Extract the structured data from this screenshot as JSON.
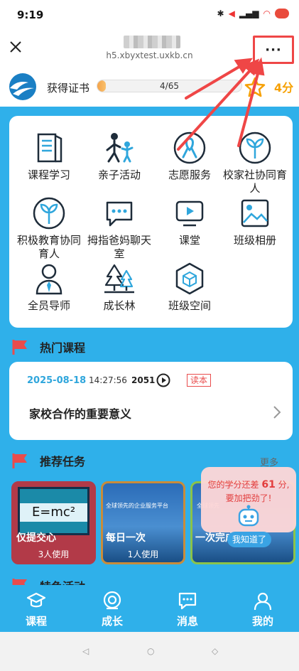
{
  "status": {
    "time": "9:19",
    "icons": [
      "bluetooth-icon",
      "mute-icon",
      "signal-icon",
      "wifi-icon",
      "battery-icon"
    ]
  },
  "browser": {
    "url": "h5.xbyxtest.uxkb.cn",
    "more_label": "···"
  },
  "cert": {
    "label": "获得证书",
    "progress_text": "4/65",
    "progress_fraction": 0.0615,
    "score": "4分"
  },
  "menu": [
    {
      "label": "课程学习",
      "icon": "book-icon"
    },
    {
      "label": "亲子活动",
      "icon": "family-icon"
    },
    {
      "label": "志愿服务",
      "icon": "ribbon-icon"
    },
    {
      "label": "校家社协同育人",
      "icon": "sprout-icon"
    },
    {
      "label": "积极教育协同育人",
      "icon": "sprout-icon"
    },
    {
      "label": "拇指爸妈聊天室",
      "icon": "chat-icon"
    },
    {
      "label": "课堂",
      "icon": "video-screen-icon"
    },
    {
      "label": "班级相册",
      "icon": "album-icon"
    },
    {
      "label": "全员导师",
      "icon": "mentor-icon"
    },
    {
      "label": "成长林",
      "icon": "trees-icon"
    },
    {
      "label": "班级空间",
      "icon": "cube-icon"
    }
  ],
  "hot": {
    "section_title": "热门课程",
    "date": "2025-08-18",
    "time": "14:27:56",
    "views": "2051",
    "tag": "读本",
    "title": "家校合作的重要意义"
  },
  "tasks": {
    "section_title": "推荐任务",
    "more": "更多",
    "items": [
      {
        "label": "仅提交心",
        "users": "3人使用",
        "image_text": "E=mc²"
      },
      {
        "label": "每日一次",
        "users": "1人使用",
        "image_text": "全球领先的企业服务平台"
      },
      {
        "label": "一次完成",
        "users": "",
        "image_text": "全球领先"
      }
    ]
  },
  "next_section": {
    "title": "特色活动"
  },
  "popup": {
    "line1_prefix": "您的学分还差",
    "value": "61",
    "line1_suffix": "分,",
    "line2": "要加把劲了!",
    "button": "我知道了"
  },
  "tabs": [
    {
      "label": "课程",
      "icon": "graduation-cap-icon"
    },
    {
      "label": "成长",
      "icon": "growth-icon"
    },
    {
      "label": "消息",
      "icon": "message-icon"
    },
    {
      "label": "我的",
      "icon": "person-icon"
    }
  ],
  "colors": {
    "primary_blue": "#2fb0ea",
    "accent_red": "#ef4646",
    "score_orange": "#f6a000",
    "date_blue": "#2fa6dc"
  }
}
